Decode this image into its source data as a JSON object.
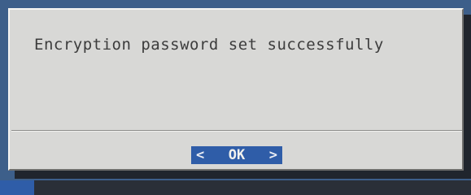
{
  "dialog": {
    "message": "Encryption password set successfully",
    "ok_button": {
      "left_marker": "<",
      "label": "OK",
      "right_marker": ">"
    }
  },
  "colors": {
    "screen_background": "#3d5f8a",
    "dialog_background": "#d8d8d6",
    "button_background": "#2f5da8",
    "text": "#3c3c3c"
  }
}
